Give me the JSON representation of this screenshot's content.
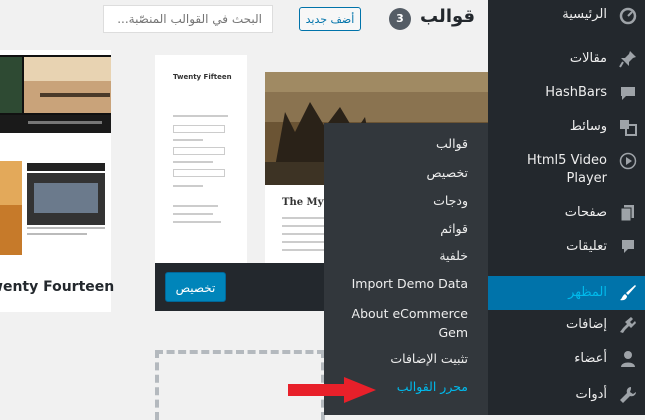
{
  "header": {
    "title": "قوالب",
    "count": "3",
    "add_new_label": "أضف جديد",
    "search_placeholder": "البحث في القوالب المنصّبة..."
  },
  "themes": {
    "card1_name": "Twenty Fourteen",
    "card2_site_title": "Twenty Fifteen",
    "card2_post_title": "The Myth",
    "customize_label": "تخصيص"
  },
  "sidebar": {
    "items": [
      {
        "label": "الرئيسية",
        "icon": "dashboard-icon"
      },
      {
        "label": "مقالات",
        "icon": "pin-icon"
      },
      {
        "label": "HashBars",
        "icon": "chat-bubble-icon"
      },
      {
        "label": "وسائط",
        "icon": "media-icon"
      },
      {
        "label": "Html5 Video Player",
        "icon": "play-circle-icon"
      },
      {
        "label": "صفحات",
        "icon": "pages-icon"
      },
      {
        "label": "تعليقات",
        "icon": "comment-icon"
      },
      {
        "label": "المظهر",
        "icon": "appearance-brush-icon"
      },
      {
        "label": "إضافات",
        "icon": "plugins-icon"
      },
      {
        "label": "أعضاء",
        "icon": "users-icon"
      },
      {
        "label": "أدوات",
        "icon": "wrench-icon"
      }
    ]
  },
  "flyout": {
    "items": [
      "قوالب",
      "تخصيص",
      "ودجات",
      "قوائم",
      "خلفية",
      "Import Demo Data",
      "About eCommerce Gem",
      "تثبيت الإضافات",
      "محرر القوالب"
    ]
  },
  "colors": {
    "sidebar_bg": "#23282d",
    "flyout_bg": "#32373c",
    "active_bg": "#0073aa",
    "arrow": "#e8202a"
  }
}
